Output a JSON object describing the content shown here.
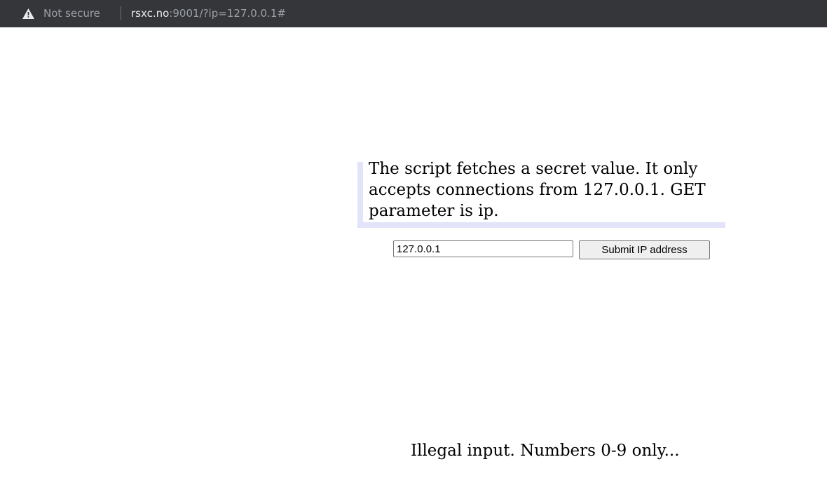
{
  "browser": {
    "security_label": "Not secure",
    "url_host": "rsxc.no",
    "url_rest": ":9001/?ip=127.0.0.1#"
  },
  "page": {
    "description": "The script fetches a secret value. It only accepts connections from 127.0.0.1. GET parameter is ip.",
    "form": {
      "ip_value": "127.0.0.1",
      "submit_label": "Submit IP address"
    },
    "result_message": "Illegal input. Numbers 0-9 only..."
  },
  "colors": {
    "toolbar_bg": "#35363a",
    "description_accent": "#e3e3f9"
  },
  "icons": {
    "security": "warning-triangle-icon"
  }
}
